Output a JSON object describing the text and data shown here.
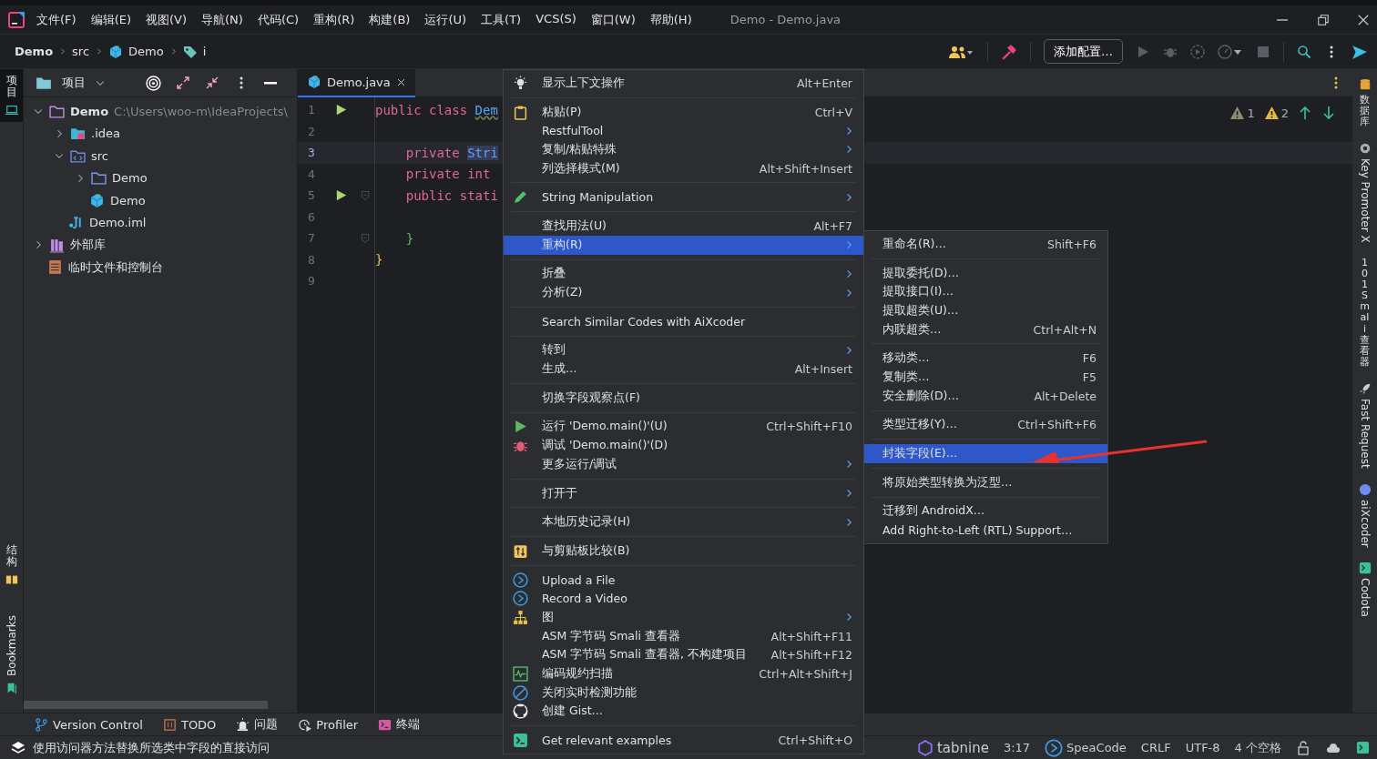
{
  "window": {
    "title": "Demo - Demo.java"
  },
  "menu_bar": [
    "文件(F)",
    "编辑(E)",
    "视图(V)",
    "导航(N)",
    "代码(C)",
    "重构(R)",
    "构建(B)",
    "运行(U)",
    "工具(T)",
    "VCS(S)",
    "窗口(W)",
    "帮助(H)"
  ],
  "breadcrumbs": [
    "Demo",
    "src",
    "Demo",
    "i"
  ],
  "toolbar": {
    "config_button": "添加配置…"
  },
  "left_strip": [
    {
      "label": "项目",
      "selected": true
    },
    {
      "label": "结构",
      "selected": false
    },
    {
      "label": "Bookmarks",
      "selected": false
    }
  ],
  "project_panel": {
    "title": "项目",
    "tree": [
      {
        "label": "Demo",
        "path": "C:\\Users\\woo-m\\IdeaProjects\\",
        "kind": "module",
        "expanded": true,
        "children": [
          {
            "label": ".idea",
            "kind": "config-folder",
            "expanded": false
          },
          {
            "label": "src",
            "kind": "source-folder",
            "expanded": true,
            "children": [
              {
                "label": "Demo",
                "kind": "folder",
                "expanded": false
              },
              {
                "label": "Demo",
                "kind": "class"
              }
            ]
          },
          {
            "label": "Demo.iml",
            "kind": "iml"
          }
        ]
      },
      {
        "label": "外部库",
        "kind": "library",
        "expanded": false
      },
      {
        "label": "临时文件和控制台",
        "kind": "scratch"
      }
    ]
  },
  "editor": {
    "tab": {
      "label": "Demo.java",
      "selected": true
    },
    "inspections": [
      {
        "kind": "weak-warning",
        "count": "1"
      },
      {
        "kind": "warning",
        "count": "2"
      }
    ],
    "lines": [
      {
        "number": "1",
        "run": true,
        "fold": false,
        "current": false,
        "tokens": [
          {
            "text": "public class ",
            "kind": "keyword"
          },
          {
            "text": "Dem",
            "kind": "type"
          }
        ]
      },
      {
        "number": "2",
        "run": false,
        "fold": false,
        "current": false
      },
      {
        "number": "3",
        "run": false,
        "fold": false,
        "current": true,
        "tokens": [
          {
            "text": "    private ",
            "kind": "keyword"
          },
          {
            "text": "Stri",
            "kind": "type-highlight"
          }
        ]
      },
      {
        "number": "4",
        "run": false,
        "fold": false,
        "current": false,
        "tokens": [
          {
            "text": "    private int",
            "kind": "keyword"
          }
        ]
      },
      {
        "number": "5",
        "run": true,
        "fold": true,
        "current": false,
        "tokens": [
          {
            "text": "    public stati",
            "kind": "keyword"
          }
        ]
      },
      {
        "number": "6",
        "run": false,
        "fold": false,
        "current": false
      },
      {
        "number": "7",
        "run": false,
        "fold": true,
        "current": false,
        "tokens": [
          {
            "text": "    }",
            "kind": "brace-inner"
          }
        ]
      },
      {
        "number": "8",
        "run": false,
        "fold": false,
        "current": false,
        "tokens": [
          {
            "text": "}",
            "kind": "brace-outer"
          }
        ]
      },
      {
        "number": "9",
        "run": false,
        "fold": false,
        "current": false
      }
    ]
  },
  "context_menu": {
    "items": [
      {
        "kind": "item",
        "label": "显示上下文操作",
        "shortcut": "Alt+Enter",
        "submenu": false,
        "selected": false
      },
      {
        "kind": "separator"
      },
      {
        "kind": "item",
        "label": "粘贴(P)",
        "shortcut": "Ctrl+V",
        "submenu": false,
        "selected": false
      },
      {
        "kind": "item",
        "label": "RestfulTool",
        "submenu": true,
        "selected": false
      },
      {
        "kind": "item",
        "label": "复制/粘贴特殊",
        "submenu": true,
        "selected": false
      },
      {
        "kind": "item",
        "label": "列选择模式(M)",
        "shortcut": "Alt+Shift+Insert",
        "submenu": false,
        "selected": false
      },
      {
        "kind": "separator"
      },
      {
        "kind": "item",
        "label": "String Manipulation",
        "submenu": true,
        "selected": false
      },
      {
        "kind": "separator"
      },
      {
        "kind": "item",
        "label": "查找用法(U)",
        "shortcut": "Alt+F7",
        "submenu": false,
        "selected": false
      },
      {
        "kind": "item",
        "label": "重构(R)",
        "submenu": true,
        "selected": true
      },
      {
        "kind": "separator"
      },
      {
        "kind": "item",
        "label": "折叠",
        "submenu": true,
        "selected": false
      },
      {
        "kind": "item",
        "label": "分析(Z)",
        "submenu": true,
        "selected": false
      },
      {
        "kind": "separator"
      },
      {
        "kind": "item",
        "label": "Search Similar Codes with AiXcoder",
        "submenu": false,
        "selected": false
      },
      {
        "kind": "separator"
      },
      {
        "kind": "item",
        "label": "转到",
        "submenu": true,
        "selected": false
      },
      {
        "kind": "item",
        "label": "生成…",
        "shortcut": "Alt+Insert",
        "submenu": false,
        "selected": false
      },
      {
        "kind": "separator"
      },
      {
        "kind": "item",
        "label": "切换字段观察点(F)",
        "submenu": false,
        "selected": false
      },
      {
        "kind": "separator"
      },
      {
        "kind": "item",
        "label": "运行 'Demo.main()'(U)",
        "shortcut": "Ctrl+Shift+F10",
        "submenu": false,
        "selected": false
      },
      {
        "kind": "item",
        "label": "调试 'Demo.main()'(D)",
        "submenu": false,
        "selected": false
      },
      {
        "kind": "item",
        "label": "更多运行/调试",
        "submenu": true,
        "selected": false
      },
      {
        "kind": "separator"
      },
      {
        "kind": "item",
        "label": "打开于",
        "submenu": true,
        "selected": false
      },
      {
        "kind": "separator"
      },
      {
        "kind": "item",
        "label": "本地历史记录(H)",
        "submenu": true,
        "selected": false
      },
      {
        "kind": "separator"
      },
      {
        "kind": "item",
        "label": "与剪贴板比较(B)",
        "submenu": false,
        "selected": false
      },
      {
        "kind": "separator"
      },
      {
        "kind": "item",
        "label": "Upload a File",
        "submenu": false,
        "selected": false
      },
      {
        "kind": "item",
        "label": "Record a Video",
        "submenu": false,
        "selected": false
      },
      {
        "kind": "item",
        "label": "图",
        "submenu": true,
        "selected": false
      },
      {
        "kind": "item",
        "label": "ASM 字节码 Smali 查看器",
        "shortcut": "Alt+Shift+F11",
        "submenu": false,
        "selected": false
      },
      {
        "kind": "item",
        "label": "ASM 字节码 Smali 查看器, 不构建项目",
        "shortcut": "Alt+Shift+F12",
        "submenu": false,
        "selected": false
      },
      {
        "kind": "item",
        "label": "编码规约扫描",
        "shortcut": "Ctrl+Alt+Shift+J",
        "submenu": false,
        "selected": false
      },
      {
        "kind": "item",
        "label": "关闭实时检测功能",
        "submenu": false,
        "selected": false
      },
      {
        "kind": "item",
        "label": "创建 Gist…",
        "submenu": false,
        "selected": false
      },
      {
        "kind": "separator"
      },
      {
        "kind": "item",
        "label": "Get relevant examples",
        "shortcut": "Ctrl+Shift+O",
        "submenu": false,
        "selected": false
      }
    ]
  },
  "submenu": {
    "items": [
      {
        "kind": "item",
        "label": "重命名(R)…",
        "shortcut": "Shift+F6",
        "selected": false
      },
      {
        "kind": "separator"
      },
      {
        "kind": "item",
        "label": "提取委托(D)…",
        "selected": false
      },
      {
        "kind": "item",
        "label": "提取接口(I)…",
        "selected": false
      },
      {
        "kind": "item",
        "label": "提取超类(U)…",
        "selected": false
      },
      {
        "kind": "item",
        "label": "内联超类…",
        "shortcut": "Ctrl+Alt+N",
        "selected": false
      },
      {
        "kind": "separator"
      },
      {
        "kind": "item",
        "label": "移动类…",
        "shortcut": "F6",
        "selected": false
      },
      {
        "kind": "item",
        "label": "复制类…",
        "shortcut": "F5",
        "selected": false
      },
      {
        "kind": "item",
        "label": "安全删除(D)…",
        "shortcut": "Alt+Delete",
        "selected": false
      },
      {
        "kind": "separator"
      },
      {
        "kind": "item",
        "label": "类型迁移(Y)…",
        "shortcut": "Ctrl+Shift+F6",
        "selected": false
      },
      {
        "kind": "separator"
      },
      {
        "kind": "item",
        "label": "封装字段(E)…",
        "selected": true
      },
      {
        "kind": "separator"
      },
      {
        "kind": "item",
        "label": "将原始类型转换为泛型…",
        "selected": false
      },
      {
        "kind": "separator"
      },
      {
        "kind": "item",
        "label": "迁移到 AndroidX…",
        "selected": false
      },
      {
        "kind": "item",
        "label": "Add Right-to-Left (RTL) Support…",
        "selected": false
      }
    ]
  },
  "right_strip": [
    "数据库",
    "Key Promoter X",
    "101 Smali查看器",
    "Fast Request",
    "aiXcoder",
    "Codota"
  ],
  "tool_windows": [
    "Version Control",
    "TODO",
    "问题",
    "Profiler",
    "终端"
  ],
  "status_bar": {
    "message": "使用访问器方法替换所选类中字段的直接访问",
    "items": [
      "tabnine",
      "3:17",
      "SpeaCode",
      "CRLF",
      "UTF-8",
      "4 个空格"
    ]
  }
}
